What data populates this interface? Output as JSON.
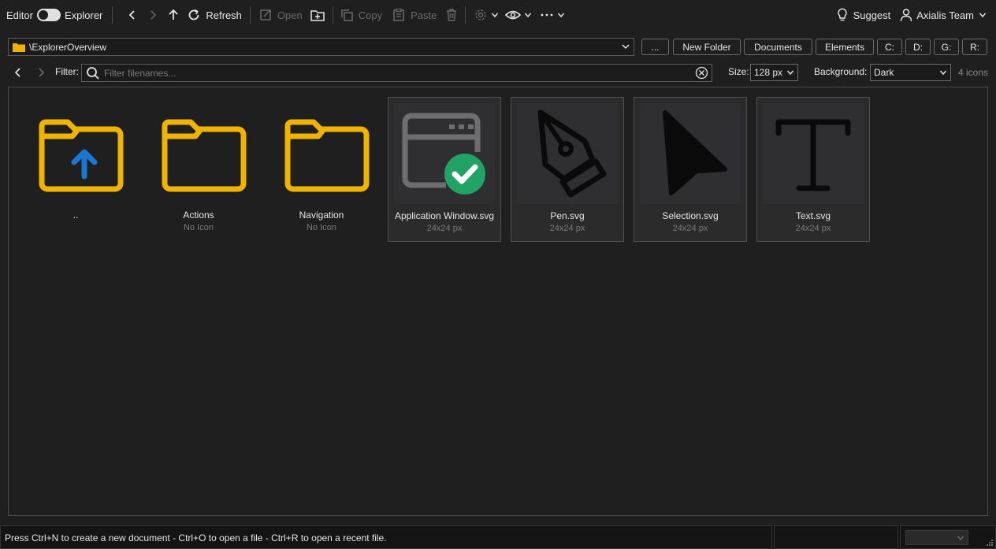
{
  "toolbar": {
    "editor_label": "Editor",
    "explorer_label": "Explorer",
    "refresh_label": "Refresh",
    "open_label": "Open",
    "copy_label": "Copy",
    "paste_label": "Paste",
    "suggest_label": "Suggest",
    "user_label": "Axialis Team"
  },
  "path": {
    "value": "\\ExplorerOverview"
  },
  "buttons": {
    "browse": "...",
    "new_folder": "New Folder",
    "documents": "Documents",
    "elements": "Elements",
    "drive_c": "C:",
    "drive_d": "D:",
    "drive_g": "G:",
    "drive_r": "R:"
  },
  "filter": {
    "label": "Filter:",
    "placeholder": "Filter filenames...",
    "size_label": "Size:",
    "size_value": "128 px",
    "background_label": "Background:",
    "background_value": "Dark",
    "icon_count": "4 icons"
  },
  "items": [
    {
      "name": "..",
      "sub": "",
      "icon": "folder-up-icon"
    },
    {
      "name": "Actions",
      "sub": "No Icon",
      "icon": "folder-icon"
    },
    {
      "name": "Navigation",
      "sub": "No Icon",
      "icon": "folder-icon"
    },
    {
      "name": "Application Window.svg",
      "sub": "24x24 px",
      "icon": "application-window-check-icon"
    },
    {
      "name": "Pen.svg",
      "sub": "24x24 px",
      "icon": "pen-icon"
    },
    {
      "name": "Selection.svg",
      "sub": "24x24 px",
      "icon": "selection-cursor-icon"
    },
    {
      "name": "Text.svg",
      "sub": "24x24 px",
      "icon": "text-icon"
    }
  ],
  "status": {
    "message": "Press Ctrl+N to create a new document - Ctrl+O to open a file - Ctrl+R to open a recent file."
  },
  "colors": {
    "folder": "#f0b400",
    "arrow": "#1976d2",
    "check": "#21a366",
    "background": "#1f1f1f"
  }
}
